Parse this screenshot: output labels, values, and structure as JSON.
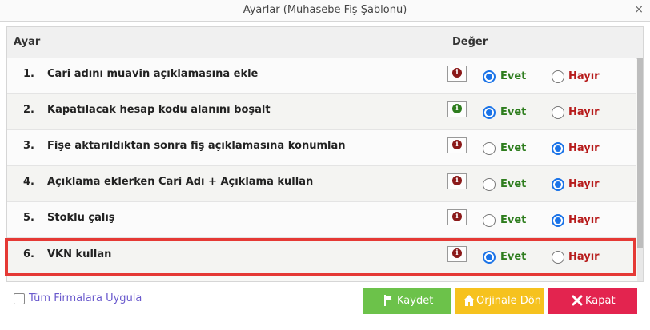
{
  "window": {
    "title": "Ayarlar (Muhasebe Fiş Şablonu)",
    "close_glyph": "×"
  },
  "table": {
    "headers": {
      "setting": "Ayar",
      "value": "Değer"
    },
    "option_yes": "Evet",
    "option_no": "Hayır",
    "rows": [
      {
        "num": "1.",
        "label": "Cari adını muavin açıklamasına ekle",
        "value": "Evet",
        "info_icon": "info-icon-red"
      },
      {
        "num": "2.",
        "label": "Kapatılacak hesap kodu alanını boşalt",
        "value": "Evet",
        "info_icon": "info-icon-green"
      },
      {
        "num": "3.",
        "label": "Fişe aktarıldıktan sonra fiş açıklamasına konumlan",
        "value": "Hayır",
        "info_icon": "info-icon-red"
      },
      {
        "num": "4.",
        "label": "Açıklama eklerken Cari Adı + Açıklama kullan",
        "value": "Hayır",
        "info_icon": "info-icon-red"
      },
      {
        "num": "5.",
        "label": "Stoklu çalış",
        "value": "Hayır",
        "info_icon": "info-icon-red"
      },
      {
        "num": "6.",
        "label": "VKN kullan",
        "value": "Evet",
        "info_icon": "info-icon-red"
      }
    ]
  },
  "footer": {
    "apply_all_label": "Tüm Firmalara Uygula",
    "save_label": "Kaydet",
    "reset_label": "Orjinale Dön",
    "close_label": "Kapat"
  },
  "colors": {
    "evet": "#2e7d1e",
    "hayir": "#b71c1c",
    "radio_accent": "#1a73e8",
    "save_button": "#6cc24a",
    "reset_button": "#f6c21e",
    "close_button": "#e3244f",
    "highlight_border": "#e53935",
    "info_red": "#8b1a1a",
    "info_green": "#2e7d1e"
  }
}
